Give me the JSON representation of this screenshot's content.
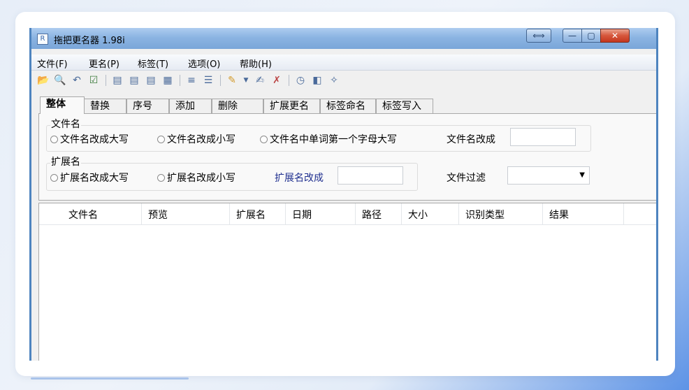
{
  "window": {
    "title": "拖把更名器 1.98i",
    "icon": "app-icon"
  },
  "titlebar_buttons": {
    "resize": "⟺",
    "minimize": "—",
    "maximize": "▢",
    "close": "✕"
  },
  "menu": [
    "文件(F)",
    "更名(P)",
    "标签(T)",
    "选项(O)",
    "帮助(H)"
  ],
  "toolbar": [
    "open-folder-icon",
    "search-icon",
    "undo-icon",
    "check-icon",
    "file-icon-1",
    "file-icon-2",
    "file-icon-3",
    "file-icon-4",
    "list-icon",
    "list-icon-2",
    "pen-icon",
    "dropdown-icon",
    "pen-doc-icon",
    "pen-delete-icon",
    "clock-icon",
    "panel-icon",
    "settings-icon"
  ],
  "tabs": [
    "整体",
    "替换",
    "序号",
    "添加",
    "删除",
    "扩展更名",
    "标签命名",
    "标签写入"
  ],
  "panel": {
    "filename_group": {
      "title": "文件名",
      "options": [
        "文件名改成大写",
        "文件名改成小写",
        "文件名中单词第一个字母大写"
      ],
      "rename_label": "文件名改成",
      "rename_value": ""
    },
    "ext_group": {
      "title": "扩展名",
      "options": [
        "扩展名改成大写",
        "扩展名改成小写"
      ],
      "rename_label": "扩展名改成",
      "rename_value": ""
    },
    "filter_label": "文件过滤",
    "filter_value": ""
  },
  "columns": [
    "文件名",
    "预览",
    "扩展名",
    "日期",
    "路径",
    "大小",
    "识别类型",
    "结果"
  ]
}
